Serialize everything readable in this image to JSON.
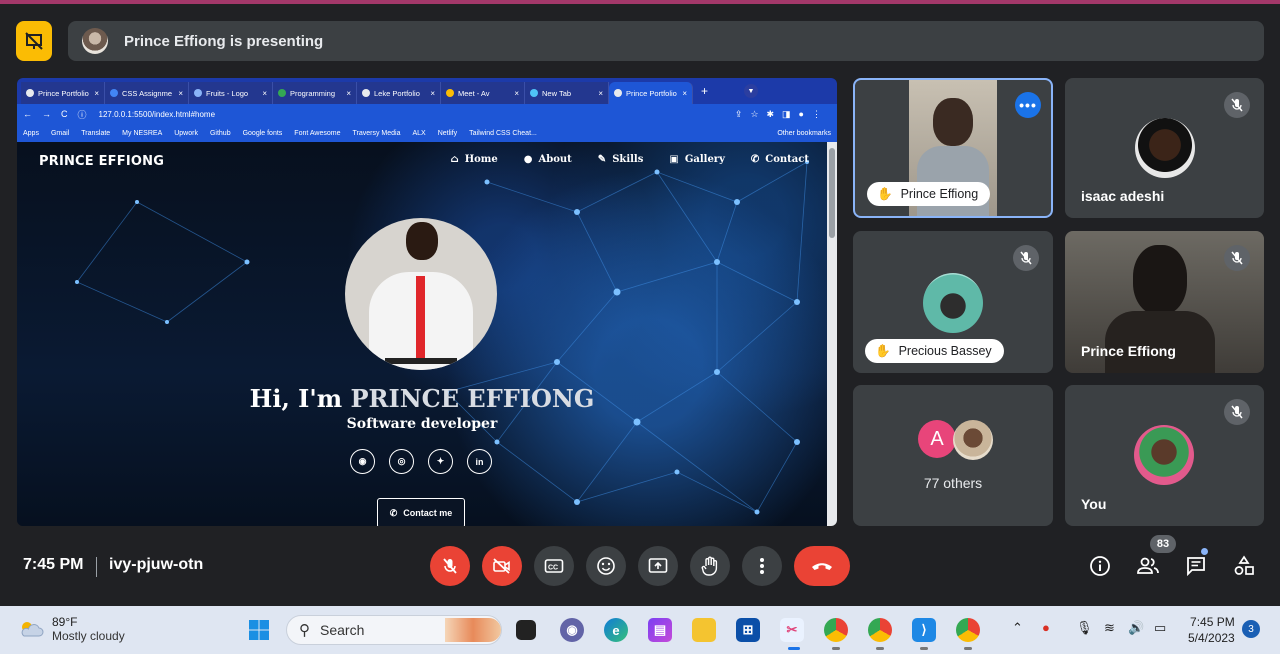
{
  "presenting": {
    "text": "Prince Effiong is presenting"
  },
  "browser": {
    "tabs": [
      {
        "label": "Prince Portfolio",
        "active": false
      },
      {
        "label": "CSS Assignme",
        "active": false
      },
      {
        "label": "Fruits - Logo",
        "active": false
      },
      {
        "label": "Programming",
        "active": false
      },
      {
        "label": "Leke Portfolio",
        "active": false
      },
      {
        "label": "Meet - Av",
        "active": false
      },
      {
        "label": "New Tab",
        "active": false
      },
      {
        "label": "Prince Portfolio",
        "active": true
      }
    ],
    "url": "127.0.0.1:5500/index.html#home",
    "bookmarks": [
      "Apps",
      "Gmail",
      "Translate",
      "My NESREA",
      "Upwork",
      "Github",
      "Google fonts",
      "Font Awesome",
      "Traversy Media",
      "ALX",
      "Netlify",
      "Tailwind CSS Cheat..."
    ],
    "other_bookmarks": "Other bookmarks"
  },
  "site": {
    "brand": "PRINCE EFFIONG",
    "nav": {
      "home": "Home",
      "about": "About",
      "skills": "Skills",
      "gallery": "Gallery",
      "contact": "Contact"
    },
    "greeting": "Hi, I'm",
    "name": "PRINCE EFFIONG",
    "role": "Software developer",
    "contact_button": "Contact me"
  },
  "participants": {
    "p1_chip": "Prince Effiong",
    "p2_name": "isaac adeshi",
    "p3_chip": "Precious Bassey",
    "p4_name": "Prince Effiong",
    "others_avatar_letter": "A",
    "others_label": "77 others",
    "you_name": "You"
  },
  "meeting": {
    "time": "7:45 PM",
    "code": "ivy-pjuw-otn",
    "people_count": "83"
  },
  "taskbar": {
    "temperature": "89°F",
    "weather": "Mostly cloudy",
    "search_label": "Search",
    "time": "7:45 PM",
    "date": "5/4/2023",
    "notifications": "3"
  },
  "colors": {
    "accent_yellow": "#fbbc04",
    "end_call_red": "#ea4335",
    "active_blue": "#8ab4f8",
    "meet_bg": "#202124",
    "tile_bg": "#3c4043"
  }
}
